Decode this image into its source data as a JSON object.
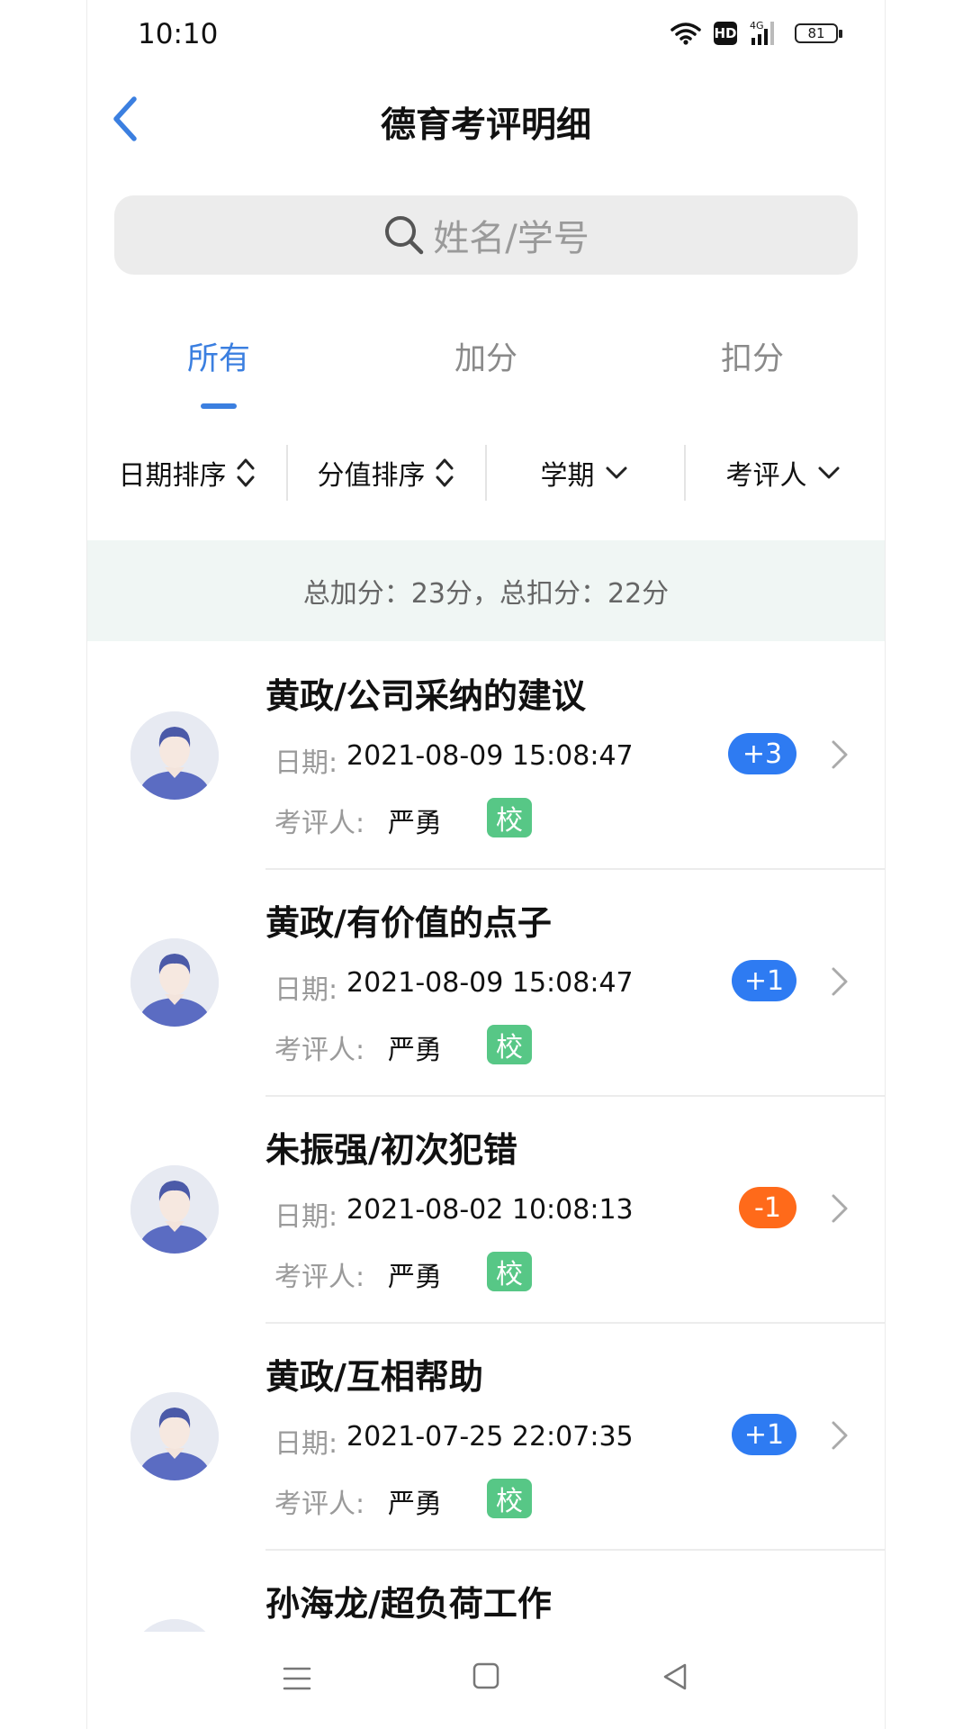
{
  "status": {
    "time": "10:10",
    "hd": "HD",
    "network": "4G",
    "battery": "81"
  },
  "header": {
    "title": "德育考评明细"
  },
  "search": {
    "placeholder": "姓名/学号"
  },
  "tabs": [
    {
      "label": "所有",
      "active": true
    },
    {
      "label": "加分",
      "active": false
    },
    {
      "label": "扣分",
      "active": false
    }
  ],
  "filters": [
    {
      "label": "日期排序",
      "icon": "sort-icon"
    },
    {
      "label": "分值排序",
      "icon": "sort-icon"
    },
    {
      "label": "学期",
      "icon": "chevron-down-icon"
    },
    {
      "label": "考评人",
      "icon": "chevron-down-icon"
    }
  ],
  "summary": {
    "text": "总加分：23分，总扣分：22分"
  },
  "items": [
    {
      "title": "黄政/公司采纳的建议",
      "date_label": "日期:",
      "date": "2021-08-09 15:08:47",
      "evaluator_label": "考评人:",
      "evaluator": "严勇",
      "badge": "校",
      "score": "+3"
    },
    {
      "title": "黄政/有价值的点子",
      "date_label": "日期:",
      "date": "2021-08-09 15:08:47",
      "evaluator_label": "考评人:",
      "evaluator": "严勇",
      "badge": "校",
      "score": "+1"
    },
    {
      "title": "朱振强/初次犯错",
      "date_label": "日期:",
      "date": "2021-08-02 10:08:13",
      "evaluator_label": "考评人:",
      "evaluator": "严勇",
      "badge": "校",
      "score": "-1"
    },
    {
      "title": "黄政/互相帮助",
      "date_label": "日期:",
      "date": "2021-07-25 22:07:35",
      "evaluator_label": "考评人:",
      "evaluator": "严勇",
      "badge": "校",
      "score": "+1"
    },
    {
      "title": "孙海龙/超负荷工作"
    }
  ],
  "colors": {
    "accent": "#3b7fe0",
    "plus": "#2e7bf2",
    "minus": "#ff6a1a",
    "school_badge": "#57c786",
    "summary_bg": "#f0f6f4"
  }
}
